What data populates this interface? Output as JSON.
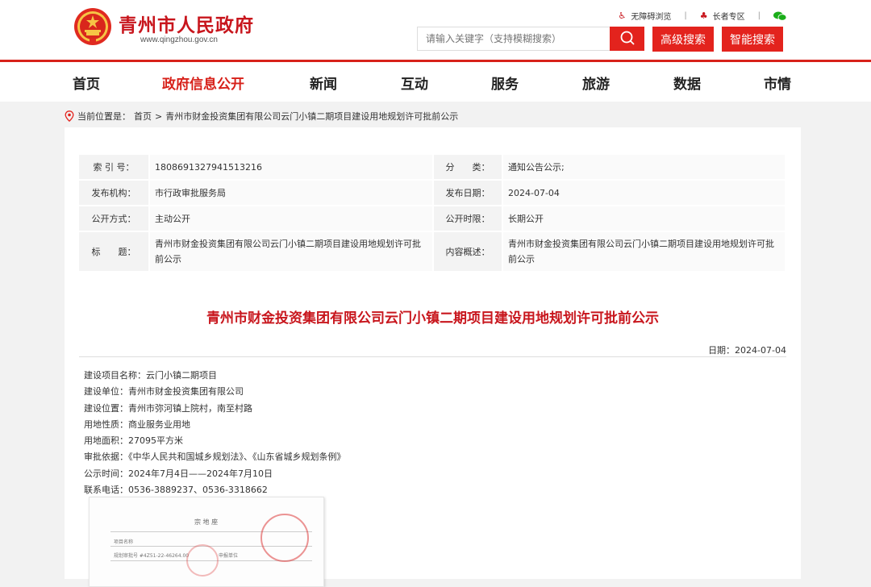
{
  "header": {
    "site_title": "青州市人民政府",
    "site_url": "www.qingzhou.gov.cn",
    "top_links": [
      {
        "label": "无障碍浏览",
        "icon": "wheelchair-icon"
      },
      {
        "label": "长者专区",
        "icon": "elder-icon"
      }
    ],
    "wechat_icon": "wechat-icon",
    "search_placeholder": "请输入关键字（支持模糊搜索）",
    "advanced_search": "高级搜索",
    "smart_search": "智能搜索",
    "accent_color": "#d7211a"
  },
  "nav": {
    "items": [
      "首页",
      "政府信息公开",
      "新闻",
      "互动",
      "服务",
      "旅游",
      "数据",
      "市情"
    ],
    "active": "政府信息公开"
  },
  "breadcrumb": {
    "label": "当前位置是：",
    "home": "首页",
    "separator": ">",
    "current": "青州市财金投资集团有限公司云门小镇二期项目建设用地规划许可批前公示"
  },
  "meta": {
    "index_label": "索 引 号：",
    "index_value": "1808691327941513216",
    "category_label": "分　　类：",
    "category_value": "通知公告公示;",
    "publisher_label": "发布机构：",
    "publisher_value": "市行政审批服务局",
    "date_label": "发布日期：",
    "date_value": "2024-07-04",
    "mode_label": "公开方式：",
    "mode_value": "主动公开",
    "period_label": "公开时限：",
    "period_value": "长期公开",
    "title_label": "标　　题：",
    "title_value": "青州市财金投资集团有限公司云门小镇二期项目建设用地规划许可批前公示",
    "summary_label": "内容概述：",
    "summary_value": "青州市财金投资集团有限公司云门小镇二期项目建设用地规划许可批前公示"
  },
  "article": {
    "title": "青州市财金投资集团有限公司云门小镇二期项目建设用地规划许可批前公示",
    "date": "日期：2024-07-04",
    "lines": [
      "建设项目名称：云门小镇二期项目",
      "建设单位：青州市财金投资集团有限公司",
      "建设位置：青州市弥河镇上院村，南至村路",
      "用地性质：商业服务业用地",
      "用地面积：27095平方米",
      "审批依据：《中华人民共和国城乡规划法》、《山东省城乡规划条例》",
      "公示时间：2024年7月4日——2024年7月10日",
      "联系电话：0536-3889237、0536-3318662"
    ],
    "scan": {
      "heading": "宗 地 座",
      "row1": "项目名称",
      "row2": "规划审批号 #4Z51-22-46264.00",
      "row3": "申报单位"
    }
  }
}
